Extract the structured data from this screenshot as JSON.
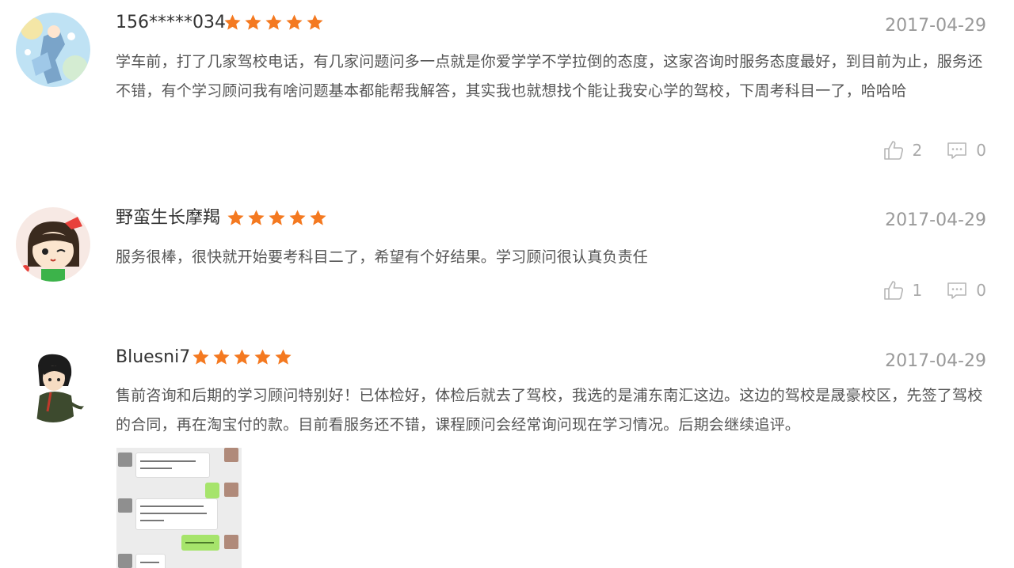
{
  "reviews": [
    {
      "username": "156*****034",
      "rating": 5,
      "date": "2017-04-29",
      "content": "学车前，打了几家驾校电话，有几家问题问多一点就是你爱学学不学拉倒的态度，这家咨询时服务态度最好，到目前为止，服务还不错，有个学习顾问我有啥问题基本都能帮我解答，其实我也就想找个能让我安心学的驾校，下周考科目一了，哈哈哈",
      "likes": "2",
      "comments": "0"
    },
    {
      "username": "野蛮生长摩羯",
      "rating": 5,
      "date": "2017-04-29",
      "content": "服务很棒，很快就开始要考科目二了，希望有个好结果。学习顾问很认真负责任",
      "likes": "1",
      "comments": "0"
    },
    {
      "username": "Bluesni7",
      "rating": 5,
      "date": "2017-04-29",
      "content": "售前咨询和后期的学习顾问特别好！已体检好，体检后就去了驾校，我选的是浦东南汇这边。这边的驾校是晟豪校区，先签了驾校的合同，再在淘宝付的款。目前看服务还不错，课程顾问会经常询问现在学习情况。后期会继续追评。"
    }
  ],
  "colors": {
    "star": "#f47920",
    "date": "#999999",
    "text": "#555555",
    "icon": "#b5b5b5"
  },
  "icons": {
    "like": "thumbs-up-icon",
    "comment": "comment-icon",
    "star": "star-icon"
  }
}
